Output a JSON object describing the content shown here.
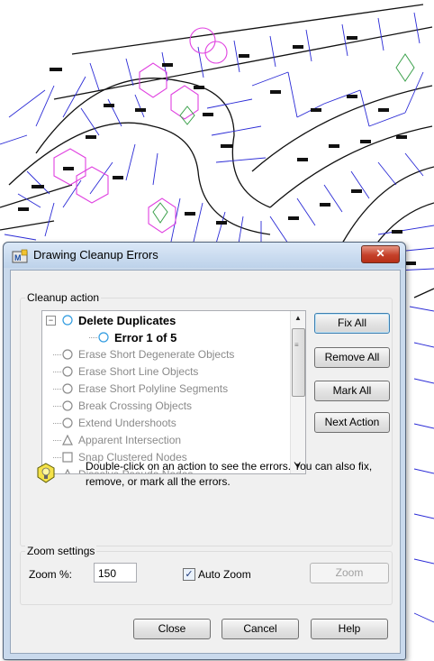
{
  "background": {
    "description_icon": "cad-parcel-map"
  },
  "dialog": {
    "title": "Drawing Cleanup Errors",
    "close_glyph": "✕",
    "cleanup_action": {
      "label": "Cleanup action",
      "tree": [
        {
          "label": "Delete Duplicates",
          "state": "expanded",
          "icon": "circle-icon",
          "active": true
        },
        {
          "label": "Error 1 of 5",
          "icon": "circle-icon",
          "active": true,
          "child": true
        },
        {
          "label": "Erase Short Degenerate Objects",
          "icon": "circle-icon"
        },
        {
          "label": "Erase Short Line Objects",
          "icon": "circle-icon"
        },
        {
          "label": "Erase Short Polyline Segments",
          "icon": "circle-icon"
        },
        {
          "label": "Break Crossing Objects",
          "icon": "circle-icon"
        },
        {
          "label": "Extend Undershoots",
          "icon": "circle-icon"
        },
        {
          "label": "Apparent Intersection",
          "icon": "triangle-icon"
        },
        {
          "label": "Snap Clustered Nodes",
          "icon": "square-icon"
        },
        {
          "label": "Dissolve Pseudo Nodes",
          "icon": "triangle-icon"
        }
      ],
      "expander_glyph": "−",
      "buttons": {
        "fix_all": "Fix All",
        "remove_all": "Remove All",
        "mark_all": "Mark All",
        "next_action": "Next Action"
      },
      "tip": "Double-click on an action to see the errors. You can also fix, remove, or mark all the errors."
    },
    "zoom_settings": {
      "label": "Zoom settings",
      "zoom_label": "Zoom %:",
      "zoom_value": "150",
      "auto_zoom_label": "Auto Zoom",
      "auto_zoom_checked": true,
      "check_glyph": "✓",
      "zoom_button": "Zoom"
    },
    "footer": {
      "close": "Close",
      "cancel": "Cancel",
      "help": "Help"
    }
  },
  "colors": {
    "map_lines": "#2b2bd6",
    "map_highlight": "#e040e0",
    "map_green": "#3aa04a"
  }
}
